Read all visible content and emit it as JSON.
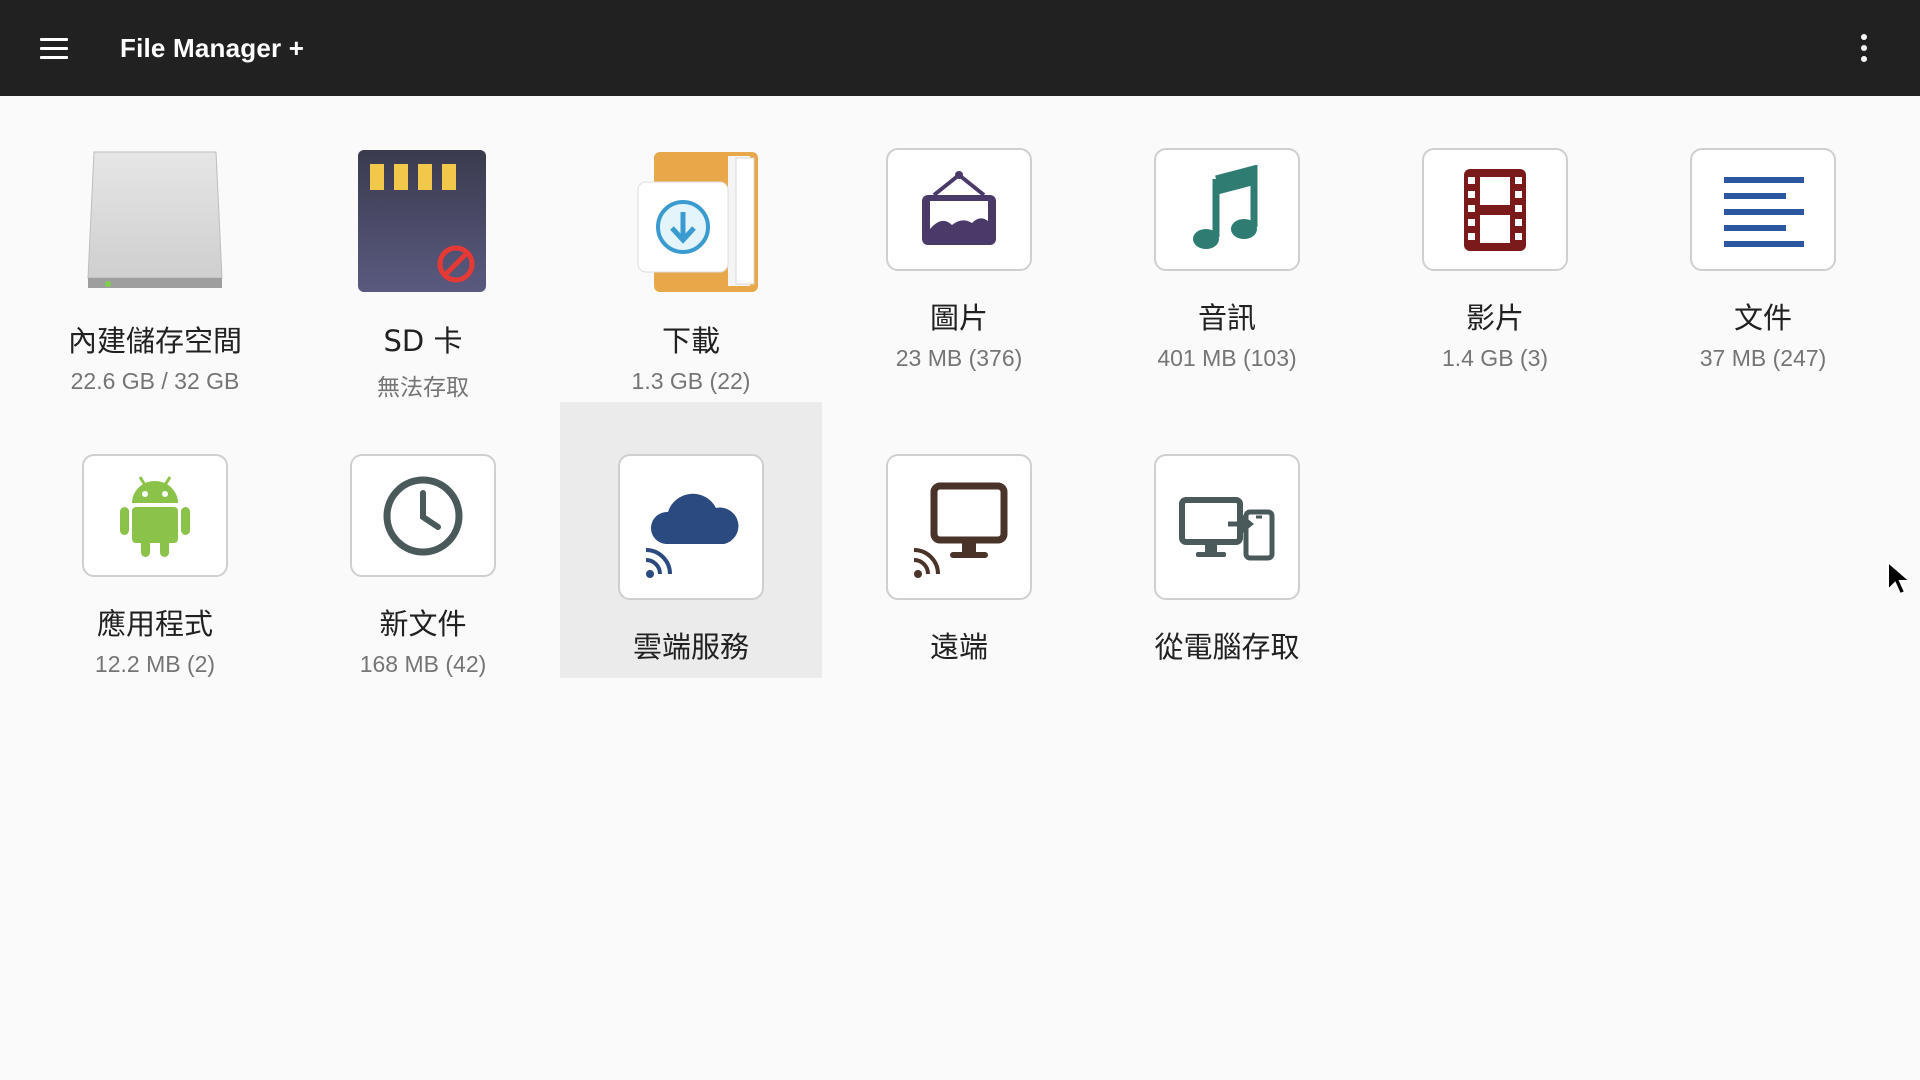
{
  "appbar": {
    "title": "File Manager +",
    "menu_icon": "hamburger-menu-icon",
    "more_icon": "more-vert-icon"
  },
  "tiles": [
    {
      "label": "內建儲存空間",
      "sub": "22.6 GB / 32 GB",
      "icon": "hard-drive-icon"
    },
    {
      "label": "SD 卡",
      "sub": "無法存取",
      "icon": "sd-card-icon"
    },
    {
      "label": "下載",
      "sub": "1.3 GB (22)",
      "icon": "download-folder-icon"
    },
    {
      "label": "圖片",
      "sub": "23 MB (376)",
      "icon": "image-icon"
    },
    {
      "label": "音訊",
      "sub": "401 MB (103)",
      "icon": "music-note-icon"
    },
    {
      "label": "影片",
      "sub": "1.4 GB (3)",
      "icon": "film-icon"
    },
    {
      "label": "文件",
      "sub": "37 MB (247)",
      "icon": "document-icon"
    },
    {
      "label": "應用程式",
      "sub": "12.2 MB (2)",
      "icon": "android-icon"
    },
    {
      "label": "新文件",
      "sub": "168 MB (42)",
      "icon": "clock-icon"
    },
    {
      "label": "雲端服務",
      "sub": "",
      "icon": "cloud-icon",
      "selected": true
    },
    {
      "label": "遠端",
      "sub": "",
      "icon": "remote-monitor-icon"
    },
    {
      "label": "從電腦存取",
      "sub": "",
      "icon": "pc-to-phone-icon"
    }
  ],
  "colors": {
    "appbar": "#212121",
    "background": "#fafafa",
    "selected_tile": "#ebebeb",
    "image_icon": "#4a3a6a",
    "music_icon": "#2f7d72",
    "film_icon": "#7a1a1a",
    "document_icon": "#2b56a0",
    "android_icon": "#8bc34a",
    "clock_icon": "#4a5a5a",
    "cloud_icon": "#2b4a80",
    "monitor_icon": "#4a3328",
    "download_icon": "#3a9bd0",
    "sd_card_icon": "#4a4a6a",
    "folder_icon": "#e8a84a"
  }
}
